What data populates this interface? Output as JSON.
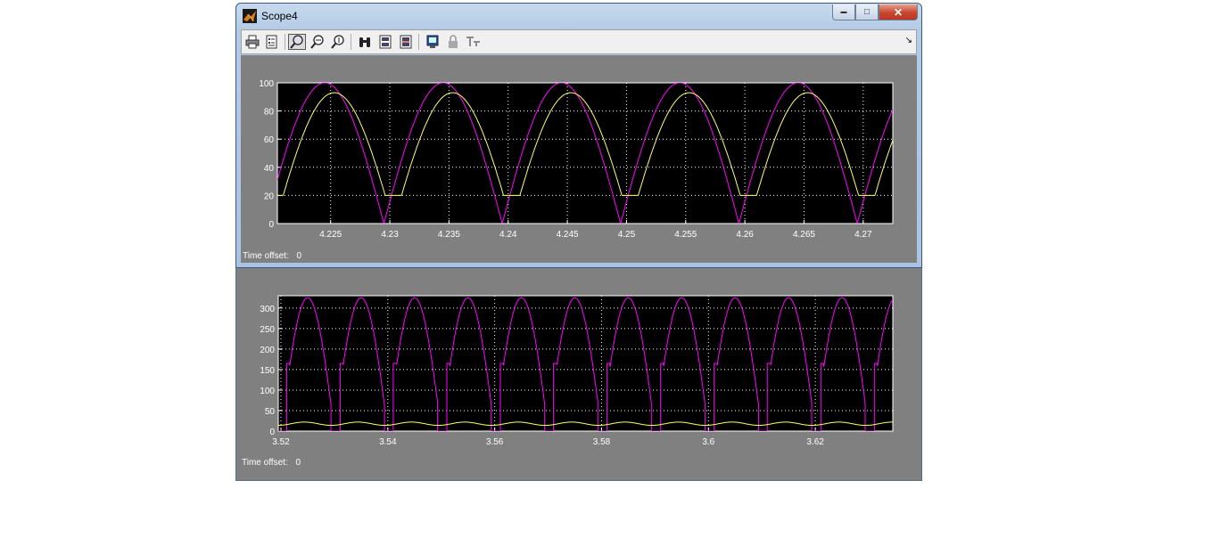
{
  "window": {
    "title": "Scope4",
    "minimize_glyph": "▬",
    "maximize_glyph": "□",
    "close_glyph": "✕"
  },
  "toolbar": {
    "buttons": [
      {
        "name": "print-icon"
      },
      {
        "name": "parameters-icon"
      },
      {
        "name": "zoom-icon",
        "active": true
      },
      {
        "name": "zoom-x-icon"
      },
      {
        "name": "zoom-y-icon"
      },
      {
        "name": "autoscale-binoculars-icon"
      },
      {
        "name": "save-axes-icon"
      },
      {
        "name": "restore-axes-icon"
      },
      {
        "name": "floating-scope-icon"
      },
      {
        "name": "lock-icon"
      },
      {
        "name": "signal-selector-icon"
      }
    ],
    "more_glyph": "↘"
  },
  "plots": [
    {
      "time_offset_label": "Time offset:",
      "time_offset_value": "0"
    },
    {
      "time_offset_label": "Time offset:",
      "time_offset_value": "0"
    }
  ],
  "colors": {
    "series1": "#ff00ff",
    "series2": "#ffff66",
    "axes_bg": "#000000",
    "figure_bg": "#808080"
  },
  "chart_data": [
    {
      "type": "line",
      "xlim": [
        4.2205,
        4.2725
      ],
      "ylim": [
        0,
        100
      ],
      "xticks": [
        "4.225",
        "4.23",
        "4.235",
        "4.24",
        "4.245",
        "4.25",
        "4.255",
        "4.26",
        "4.265",
        "4.27"
      ],
      "xtick_values": [
        4.225,
        4.23,
        4.235,
        4.24,
        4.245,
        4.25,
        4.255,
        4.26,
        4.265,
        4.27
      ],
      "yticks": [
        "0",
        "20",
        "40",
        "60",
        "80",
        "100"
      ],
      "ytick_values": [
        0,
        20,
        40,
        60,
        80,
        100
      ],
      "grid": true,
      "series": [
        {
          "color": "#ff00ff",
          "kind": "rectified_sine",
          "amplitude": 100,
          "period": 0.01,
          "zero_at": 4.2295,
          "floor": 0
        },
        {
          "color": "#ffff66",
          "kind": "rectified_sine",
          "amplitude": 93,
          "period": 0.01,
          "zero_at": 4.2295,
          "phase_lag": 0.0008,
          "floor": 20
        }
      ]
    },
    {
      "type": "line",
      "xlim": [
        3.5195,
        3.6345
      ],
      "ylim": [
        0,
        330
      ],
      "xticks": [
        "3.52",
        "3.54",
        "3.56",
        "3.58",
        "3.6",
        "3.62"
      ],
      "xtick_values": [
        3.52,
        3.54,
        3.56,
        3.58,
        3.6,
        3.62
      ],
      "yticks": [
        "0",
        "50",
        "100",
        "150",
        "200",
        "250",
        "300"
      ],
      "ytick_values": [
        0,
        50,
        100,
        150,
        200,
        250,
        300
      ],
      "grid": true,
      "series": [
        {
          "color": "#ff00ff",
          "kind": "chopped_rectified",
          "amplitude": 325,
          "period": 0.01,
          "zero_at": 3.53,
          "on_level": 165
        },
        {
          "color": "#ffff66",
          "kind": "ripple",
          "mean": 18,
          "ripple": 4,
          "period": 0.01,
          "zero_at": 3.53
        }
      ]
    }
  ]
}
